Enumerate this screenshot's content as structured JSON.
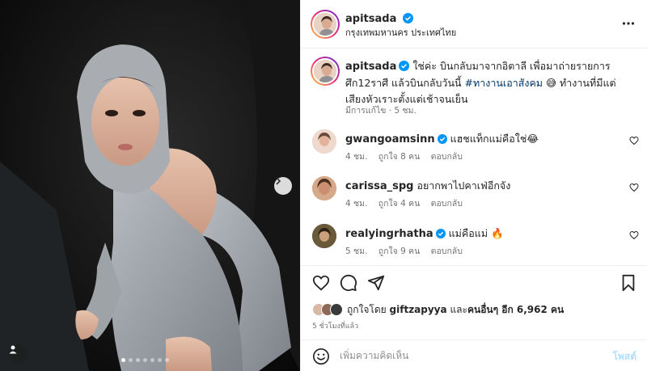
{
  "post": {
    "author": "apitsada",
    "location": "กรุงเทพมหานคร ประเทศไทย",
    "verified": true
  },
  "photo": {
    "carousel_count": 7,
    "active_index": 0
  },
  "caption": {
    "username": "apitsada",
    "text_before": "ใช่ค่ะ บินกลับมาจากอิตาลี เพื่อมาถ่ายรายการศึก12ราศี แล้วบินกลับวันนี้ ",
    "hashtag": "#ทางานเอาสังคม",
    "text_after": " 😅 ทำงานที่มีแต่เสียงหัวเราะตั้งแต่เช้าจนเย็น",
    "meta": "มีการแก้ไข · 5 ชม."
  },
  "comments": [
    {
      "username": "gwangoamsinn",
      "verified": true,
      "text": "แฮชแท็กแม่คือใช่😂",
      "time": "4 ชม.",
      "likes": "ถูกใจ 8 คน",
      "reply": "ตอบกลับ"
    },
    {
      "username": "carissa_spg",
      "verified": false,
      "text": "อยากพาไปคาเฟ่อีกจัง",
      "time": "4 ชม.",
      "likes": "ถูกใจ 4 คน",
      "reply": "ตอบกลับ"
    },
    {
      "username": "realyingrhatha",
      "verified": true,
      "text": "แม่คือแม่ 🔥",
      "time": "5 ชม.",
      "likes": "ถูกใจ 9 คน",
      "reply": "ตอบกลับ"
    }
  ],
  "likes": {
    "prefix": "ถูกใจโดย",
    "first_user": "giftzapyya",
    "middle": "และ",
    "others": "คนอื่นๆ อีก 6,962 คน"
  },
  "time_ago": "5 ชั่วโมงที่แล้ว",
  "comment_input": {
    "placeholder": "เพิ่มความคิดเห็น",
    "post_label": "โพสต์"
  },
  "icons": {
    "verified": "verified-badge-icon",
    "more": "more-options-icon",
    "heart": "heart-icon",
    "comment": "comment-icon",
    "share": "share-icon",
    "save": "bookmark-icon",
    "emoji": "emoji-icon",
    "next": "chevron-right-icon",
    "tag": "user-tag-icon"
  },
  "colors": {
    "link": "#00376b",
    "verified": "#0095f6",
    "muted": "#737373",
    "post_button_disabled": "#b2dffc"
  }
}
